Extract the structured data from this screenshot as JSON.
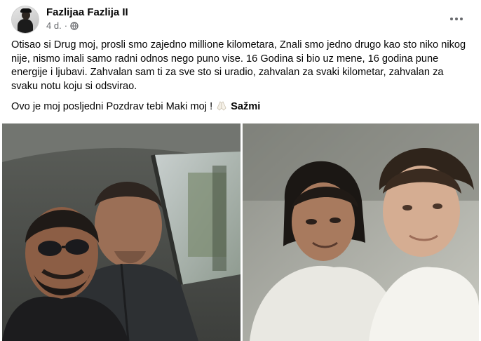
{
  "post": {
    "author": "Fazlijaa Fazlija II",
    "time": "4 d.",
    "separator": "·",
    "privacy_icon": "globe-icon",
    "more_icon": "more-options-icon",
    "paragraph_1": "Otisao si Drug moj, prosli smo zajedno millione kilometara, Znali smo jedno drugo kao sto niko nikog  nije, nismo imali samo radni odnos nego puno vise. 16 Godina si bio uz mene, 16 godina pune energije i ljubavi. Zahvalan sam ti za sve sto si uradio, zahvalan za svaki kilometar, zahvalan za svaku notu koju si odsvirao.",
    "paragraph_2": "Ovo je moj posljedni Pozdrav tebi Maki moj !",
    "emoji_icon": "praying-hands-icon",
    "see_less_label": "Sažmi"
  },
  "photos": [
    {
      "name": "car-selfie-photo"
    },
    {
      "name": "vintage-portrait-photo"
    }
  ]
}
